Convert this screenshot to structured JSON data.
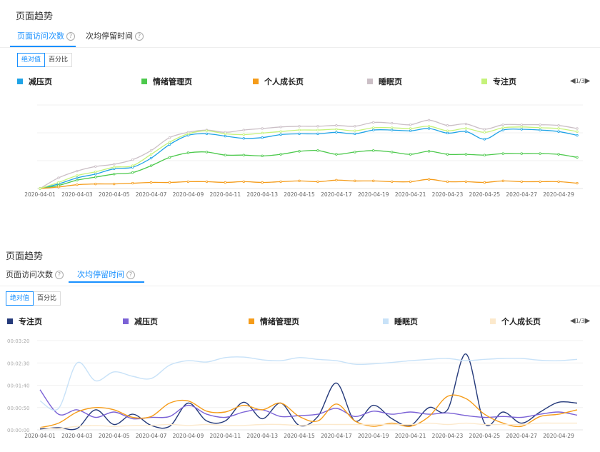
{
  "charts": [
    {
      "section_title": "页面趋势",
      "tabs": [
        {
          "label": "页面访问次数",
          "active": true
        },
        {
          "label": "次均停留时间",
          "active": false
        }
      ],
      "toggle": [
        {
          "label": "绝对值",
          "active": true
        },
        {
          "label": "百分比",
          "active": false
        }
      ],
      "pager": "1/3",
      "chart_data": {
        "type": "line",
        "x": [
          "2020-04-01",
          "2020-04-02",
          "2020-04-03",
          "2020-04-04",
          "2020-04-05",
          "2020-04-06",
          "2020-04-07",
          "2020-04-08",
          "2020-04-09",
          "2020-04-10",
          "2020-04-11",
          "2020-04-12",
          "2020-04-13",
          "2020-04-14",
          "2020-04-15",
          "2020-04-16",
          "2020-04-17",
          "2020-04-18",
          "2020-04-19",
          "2020-04-20",
          "2020-04-21",
          "2020-04-22",
          "2020-04-23",
          "2020-04-24",
          "2020-04-25",
          "2020-04-26",
          "2020-04-27",
          "2020-04-28",
          "2020-04-29",
          "2020-04-30"
        ],
        "x_tick_labels": [
          "2020-04-01",
          "2020-04-03",
          "2020-04-05",
          "2020-04-07",
          "2020-04-09",
          "2020-04-11",
          "2020-04-13",
          "2020-04-15",
          "2020-04-17",
          "2020-04-19",
          "2020-04-21",
          "2020-04-23",
          "2020-04-25",
          "2020-04-27",
          "2020-04-29"
        ],
        "y_tick_labels": [],
        "ylim": [
          0,
          110
        ],
        "grid": "horizontal",
        "legend_position": "top",
        "series": [
          {
            "name": "减压页",
            "color": "#1fa3e6",
            "values": [
              0,
              6,
              14,
              19,
              26,
              28,
              40,
              58,
              70,
              72,
              69,
              66,
              67,
              71,
              72,
              72,
              74,
              72,
              77,
              77,
              76,
              79,
              73,
              75,
              65,
              77,
              78,
              77,
              75,
              70
            ]
          },
          {
            "name": "情绪管理页",
            "color": "#4cc94c",
            "values": [
              0,
              4,
              11,
              15,
              19,
              21,
              30,
              41,
              47,
              48,
              44,
              44,
              43,
              45,
              49,
              50,
              45,
              48,
              50,
              48,
              45,
              49,
              45,
              45,
              44,
              46,
              46,
              46,
              45,
              41
            ]
          },
          {
            "name": "个人成长页",
            "color": "#f59c1a",
            "values": [
              0,
              2,
              5,
              6,
              6,
              7,
              8,
              8,
              9,
              9,
              8,
              9,
              8,
              9,
              10,
              9,
              11,
              10,
              10,
              9,
              9,
              12,
              9,
              9,
              8,
              10,
              9,
              9,
              9,
              7
            ]
          },
          {
            "name": "睡眠页",
            "color": "#cbbfc6",
            "values": [
              0,
              14,
              23,
              29,
              32,
              38,
              50,
              67,
              74,
              77,
              74,
              77,
              79,
              81,
              82,
              82,
              83,
              82,
              87,
              86,
              84,
              90,
              83,
              85,
              78,
              84,
              84,
              84,
              83,
              79
            ]
          },
          {
            "name": "专注页",
            "color": "#c5f27a",
            "values": [
              0,
              8,
              17,
              22,
              28,
              30,
              45,
              61,
              72,
              76,
              72,
              71,
              73,
              75,
              77,
              77,
              78,
              76,
              80,
              80,
              79,
              82,
              76,
              79,
              74,
              80,
              81,
              80,
              79,
              75
            ]
          }
        ]
      }
    },
    {
      "section_title": "页面趋势",
      "tabs": [
        {
          "label": "页面访问次数",
          "active": false
        },
        {
          "label": "次均停留时间",
          "active": true
        }
      ],
      "toggle": [
        {
          "label": "绝对值",
          "active": true
        },
        {
          "label": "百分比",
          "active": false
        }
      ],
      "pager": "1/3",
      "chart_data": {
        "type": "line",
        "x": [
          "2020-04-01",
          "2020-04-02",
          "2020-04-03",
          "2020-04-04",
          "2020-04-05",
          "2020-04-06",
          "2020-04-07",
          "2020-04-08",
          "2020-04-09",
          "2020-04-10",
          "2020-04-11",
          "2020-04-12",
          "2020-04-13",
          "2020-04-14",
          "2020-04-15",
          "2020-04-16",
          "2020-04-17",
          "2020-04-18",
          "2020-04-19",
          "2020-04-20",
          "2020-04-21",
          "2020-04-22",
          "2020-04-23",
          "2020-04-24",
          "2020-04-25",
          "2020-04-26",
          "2020-04-27",
          "2020-04-28",
          "2020-04-29",
          "2020-04-30"
        ],
        "x_tick_labels": [
          "2020-04-01",
          "2020-04-03",
          "2020-04-05",
          "2020-04-07",
          "2020-04-09",
          "2020-04-11",
          "2020-04-13",
          "2020-04-15",
          "2020-04-17",
          "2020-04-19",
          "2020-04-21",
          "2020-04-23",
          "2020-04-25",
          "2020-04-27",
          "2020-04-29"
        ],
        "y_tick_labels": [
          "00:00:00",
          "00:00:50",
          "00:01:40",
          "00:02:30",
          "00:03:20"
        ],
        "ylabel_unit": "seconds",
        "ylim": [
          0,
          200
        ],
        "grid": "horizontal",
        "legend_position": "top",
        "series": [
          {
            "name": "专注页",
            "color": "#253a7a",
            "values": [
              2,
              5,
              3,
              45,
              12,
              35,
              10,
              8,
              60,
              20,
              20,
              62,
              25,
              60,
              10,
              30,
              105,
              20,
              55,
              25,
              10,
              50,
              45,
              170,
              15,
              40,
              15,
              40,
              62,
              60
            ]
          },
          {
            "name": "减压页",
            "color": "#7b62d6",
            "values": [
              90,
              35,
              45,
              28,
              40,
              25,
              28,
              30,
              55,
              35,
              28,
              40,
              45,
              30,
              32,
              35,
              48,
              30,
              42,
              35,
              40,
              35,
              38,
              32,
              28,
              30,
              28,
              35,
              40,
              33
            ]
          },
          {
            "name": "情绪管理页",
            "color": "#f59c1a",
            "values": [
              5,
              15,
              40,
              50,
              45,
              28,
              30,
              60,
              65,
              42,
              40,
              55,
              45,
              60,
              30,
              20,
              58,
              20,
              8,
              15,
              8,
              30,
              75,
              70,
              35,
              15,
              8,
              30,
              35,
              45
            ]
          },
          {
            "name": "睡眠页",
            "color": "#c8e2f8",
            "values": [
              65,
              48,
              150,
              110,
              130,
              120,
              115,
              145,
              155,
              152,
              162,
              163,
              157,
              155,
              162,
              158,
              155,
              147,
              148,
              151,
              155,
              158,
              160,
              155,
              158,
              160,
              160,
              156,
              155,
              158
            ]
          },
          {
            "name": "个人成长页",
            "color": "#fce9cc",
            "values": [
              5,
              3,
              8,
              10,
              8,
              10,
              10,
              12,
              10,
              12,
              10,
              10,
              12,
              12,
              10,
              12,
              12,
              12,
              12,
              12,
              12,
              15,
              12,
              15,
              12,
              12,
              12,
              15,
              15,
              15
            ]
          }
        ]
      }
    }
  ]
}
